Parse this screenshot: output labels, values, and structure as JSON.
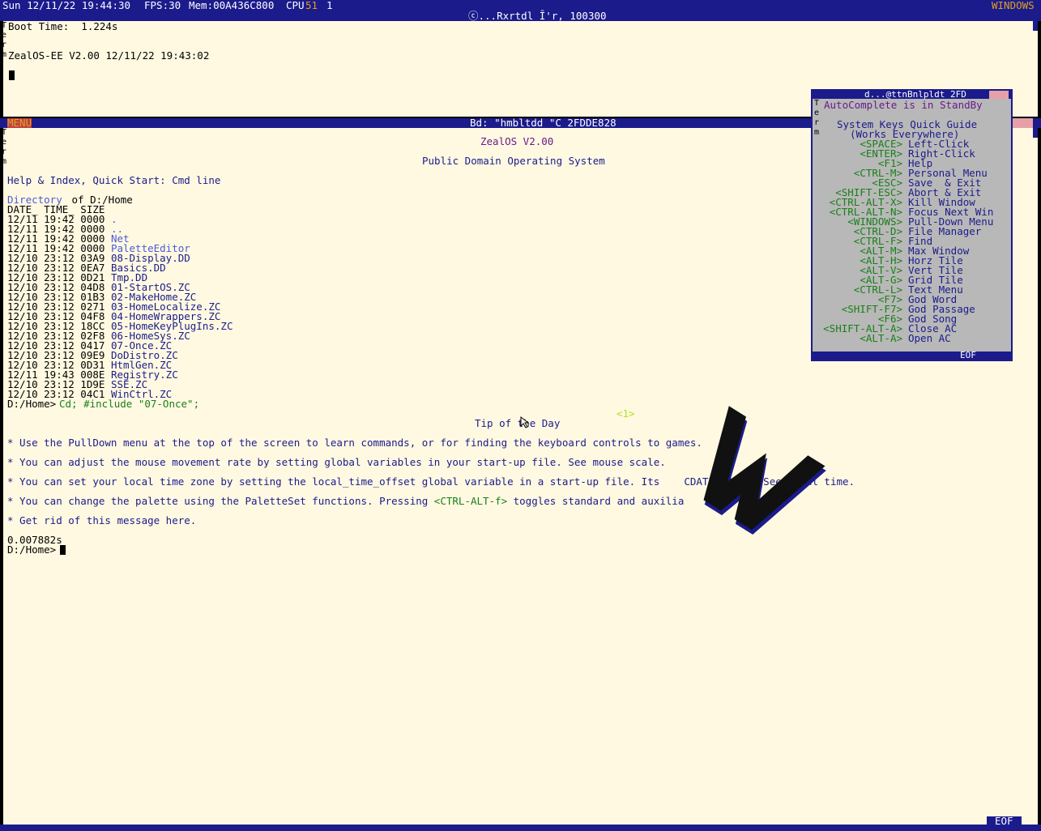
{
  "status_bar": {
    "clock": "Sun 12/11/22 19:44:30",
    "fps": "FPS:30",
    "mem": "Mem:00A436C800",
    "cpu_label": "CPU",
    "cpu_value": "51",
    "cpu_num": "1",
    "windows_label": "WINDOWS"
  },
  "term_top": {
    "title": "ⓒ...Rxrtdl Ī'r, 100300",
    "side_label": [
      "T",
      "e",
      "r",
      "m"
    ],
    "boot_time": "Boot Time:  1.224s",
    "version": "ZealOS-EE V2.00 12/11/22 19:43:02"
  },
  "term_main": {
    "menu_label": "MENU",
    "title": "Bd: \"hmbltdd \"C 2FDDE828",
    "side_label": [
      "T",
      "e",
      "r",
      "m"
    ],
    "os_title": "ZealOS V2.00",
    "subtitle": "Public Domain Operating System",
    "help_line": "Help & Index, Quick Start: Cmd line",
    "dir_link": "Directory",
    "dir_of": " of D:/Home",
    "dir_header": "DATE_ TIME_ SIZE",
    "dir_rows": [
      {
        "meta": "12/11 19:42 0000",
        "name": ".",
        "link": true
      },
      {
        "meta": "12/11 19:42 0000",
        "name": "..",
        "link": true
      },
      {
        "meta": "12/11 19:42 0000",
        "name": "Net",
        "link": true
      },
      {
        "meta": "12/11 19:42 0000",
        "name": "PaletteEditor",
        "link": true
      },
      {
        "meta": "12/10 23:12 03A9",
        "name": "08-Display.DD",
        "link": false
      },
      {
        "meta": "12/10 23:12 0EA7",
        "name": "Basics.DD",
        "link": false
      },
      {
        "meta": "12/10 23:12 0D21",
        "name": "Tmp.DD",
        "link": false
      },
      {
        "meta": "12/10 23:12 04D8",
        "name": "01-StartOS.ZC",
        "link": false
      },
      {
        "meta": "12/10 23:12 01B3",
        "name": "02-MakeHome.ZC",
        "link": false
      },
      {
        "meta": "12/10 23:12 0271",
        "name": "03-HomeLocalize.ZC",
        "link": false
      },
      {
        "meta": "12/10 23:12 04F8",
        "name": "04-HomeWrappers.ZC",
        "link": false
      },
      {
        "meta": "12/10 23:12 18CC",
        "name": "05-HomeKeyPlugIns.ZC",
        "link": false
      },
      {
        "meta": "12/10 23:12 02F8",
        "name": "06-HomeSys.ZC",
        "link": false
      },
      {
        "meta": "12/10 23:12 0417",
        "name": "07-Once.ZC",
        "link": false
      },
      {
        "meta": "12/10 23:12 09E9",
        "name": "DoDistro.ZC",
        "link": false
      },
      {
        "meta": "12/10 23:12 0D31",
        "name": "HtmlGen.ZC",
        "link": false
      },
      {
        "meta": "12/11 19:43 008E",
        "name": "Registry.ZC",
        "link": false
      },
      {
        "meta": "12/10 23:12 1D9E",
        "name": "SSE.ZC",
        "link": false
      },
      {
        "meta": "12/10 23:12 04C1",
        "name": "WinCtrl.ZC",
        "link": false
      }
    ],
    "prompt1": "D:/Home>",
    "cmd1": "Cd; #include \"07-Once\";",
    "tip_counter": "<1>",
    "tip_title": "Tip of the Day",
    "tips": {
      "t1": "* Use the PullDown menu at the top of the screen to learn commands, or for finding the keyboard controls to games.",
      "t2": "* You can adjust the mouse movement rate by setting global variables in your start-up file. See mouse scale.",
      "t3": "* You can set your local time zone by setting the local_time_offset global variable in a start-up file. Its    CDATE_FREQ.  See local time.",
      "t4a": "* You can change the palette using the PaletteSet functions. Pressing ",
      "t4b": "<CTRL-ALT-f>",
      "t4c": " toggles standard and auxilia",
      "t5": "* Get rid of this message here."
    },
    "elapsed": "0.007882s",
    "prompt2": "D:/Home>",
    "eof": "EOF"
  },
  "autocomplete": {
    "title": "d...@ttnBnlpldt 2FD",
    "side_label": [
      "T",
      "e",
      "r",
      "m"
    ],
    "status": "AutoComplete is in StandBy",
    "guide_title": "System Keys Quick Guide",
    "guide_sub": "(Works Everywhere)",
    "keys": [
      {
        "key": "<SPACE>",
        "action": "Left-Click"
      },
      {
        "key": "<ENTER>",
        "action": "Right-Click"
      },
      {
        "key": "<F1>",
        "action": "Help"
      },
      {
        "key": "<CTRL-M>",
        "action": "Personal Menu"
      },
      {
        "key": "<ESC>",
        "action": "Save  & Exit"
      },
      {
        "key": "<SHIFT-ESC>",
        "action": "Abort & Exit"
      },
      {
        "key": "<CTRL-ALT-X>",
        "action": "Kill Window"
      },
      {
        "key": "<CTRL-ALT-N>",
        "action": "Focus Next Win"
      },
      {
        "key": "<WINDOWS>",
        "action": "Pull-Down Menu"
      },
      {
        "key": "<CTRL-D>",
        "action": "File Manager"
      },
      {
        "key": "<CTRL-F>",
        "action": "Find"
      },
      {
        "key": "<ALT-M>",
        "action": "Max Window"
      },
      {
        "key": "<ALT-H>",
        "action": "Horz Tile"
      },
      {
        "key": "<ALT-V>",
        "action": "Vert Tile"
      },
      {
        "key": "<ALT-G>",
        "action": "Grid Tile"
      },
      {
        "key": "<CTRL-L>",
        "action": "Text Menu"
      },
      {
        "key": "<F7>",
        "action": "God Word"
      },
      {
        "key": "<SHIFT-F7>",
        "action": "God Passage"
      },
      {
        "key": "<F6>",
        "action": "God Song"
      },
      {
        "key": "<SHIFT-ALT-A>",
        "action": "Close AC"
      },
      {
        "key": "<ALT-A>",
        "action": "Open AC"
      }
    ],
    "eof": "EOF"
  }
}
